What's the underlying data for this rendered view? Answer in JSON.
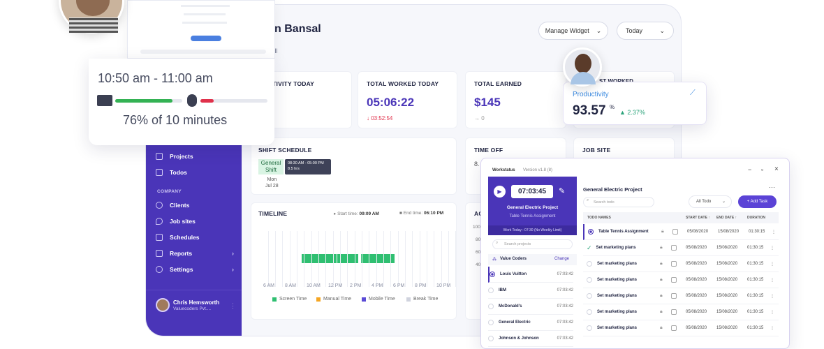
{
  "dashboard": {
    "user_name": "aran Bansal",
    "tab_all": "All",
    "manage_widget": "Manage Widget",
    "period": "Today",
    "cards": {
      "activity": {
        "title": "L ACTIVITY TODAY",
        "value": "%"
      },
      "worked": {
        "title": "TOTAL WORKED TODAY",
        "value": "05:06:22",
        "delta": "↓ 03:52:54"
      },
      "earned": {
        "title": "TOTAL EARNED",
        "value": "$145",
        "delta": "→ 0"
      },
      "shift": {
        "title": "SHIFT SCHEDULE",
        "chip_line1": "General",
        "chip_line2": "Shift",
        "tip_time": "08:30 AM - 05:00 PM",
        "tip_hours": "8.5 hrs",
        "day": "Mon",
        "date": "Jul 28"
      },
      "timeoff": {
        "title": "TIME OFF",
        "value": "8."
      },
      "jobsite": {
        "title": "JOB SITE"
      },
      "timeline": {
        "title": "TIMELINE",
        "start_label": "Start time:",
        "start_value": "09:09 AM",
        "end_label": "End time:",
        "end_value": "06:10 PM",
        "hours": [
          "6 AM",
          "8 AM",
          "10 AM",
          "12 PM",
          "2 PM",
          "4 PM",
          "6 PM",
          "8 PM",
          "10 PM"
        ],
        "legend": [
          "Screen Time",
          "Manual Time",
          "Mobile Time",
          "Break Time"
        ],
        "legend_colors": [
          "#2fbf71",
          "#f5a623",
          "#5b4bd6",
          "#d0d3de"
        ]
      },
      "activity2": {
        "title": "AC",
        "tick1": "100",
        "tick2": "80",
        "tick3": "60",
        "tick4": "40"
      }
    },
    "sidebar": {
      "items_top": [
        {
          "label": "Projects",
          "icon": "projects-icon"
        },
        {
          "label": "Todos",
          "icon": "todos-icon"
        }
      ],
      "section": "COMPANY",
      "items": [
        {
          "label": "Clients",
          "icon": "clients-icon"
        },
        {
          "label": "Job sites",
          "icon": "jobsites-icon"
        },
        {
          "label": "Schedules",
          "icon": "schedules-icon"
        },
        {
          "label": "Reports",
          "icon": "reports-icon",
          "chevron": "›"
        },
        {
          "label": "Settings",
          "icon": "settings-icon",
          "chevron": "›"
        }
      ],
      "profile_name": "Chris Hemsworth",
      "profile_company": "Valuecoders Pvt...."
    }
  },
  "activity_popup": {
    "time_range": "10:50 am - 11:00 am",
    "summary": "76% of 10 minutes",
    "keyboard_level": 0.85,
    "mouse_level": 0.2
  },
  "productivity_popup": {
    "label": "Productivity",
    "value": "93.57",
    "unit": "%",
    "change": "▲ 2.37%",
    "hidden_title": "ST WORKED"
  },
  "workstatus": {
    "app_name": "Workstatus",
    "version": "Version v1.8 (8)",
    "timer": "07:03:45",
    "project": "General Electric Project",
    "task": "Table Tennis Assignment",
    "work_today": "Work Today : 07:30 (No Weekly Limit)",
    "search_projects": "Search projects",
    "org": "Value Coders",
    "change": "Change",
    "projects": [
      {
        "name": "Louis Vuitton",
        "time": "07:03:42"
      },
      {
        "name": "IBM",
        "time": "07:03:42"
      },
      {
        "name": "McDonald's",
        "time": "07:03:42"
      },
      {
        "name": "General Electric",
        "time": "07:03:42"
      },
      {
        "name": "Johnson & Johnson",
        "time": "07:03:42"
      }
    ],
    "right_title": "General Electric Project",
    "search_todo": "Search todo",
    "filter": "All Todo",
    "add_task": "+ Add Task",
    "headers": [
      "TODO NAMES",
      "START DATE ↑",
      "END DATE ↑",
      "DURATION"
    ],
    "todos": [
      {
        "name": "Table Tennis Assignment",
        "start": "05/08/2020",
        "end": "15/08/2020",
        "dur": "01:30:15"
      },
      {
        "name": "Set marketing plans",
        "start": "05/08/2020",
        "end": "15/08/2020",
        "dur": "01:30:15"
      },
      {
        "name": "Set marketing plans",
        "start": "05/08/2020",
        "end": "15/08/2020",
        "dur": "01:30:15"
      },
      {
        "name": "Set marketing plans",
        "start": "05/08/2020",
        "end": "15/08/2020",
        "dur": "01:30:15"
      },
      {
        "name": "Set marketing plans",
        "start": "05/08/2020",
        "end": "15/08/2020",
        "dur": "01:30:15"
      },
      {
        "name": "Set marketing plans",
        "start": "05/08/2020",
        "end": "15/08/2020",
        "dur": "01:30:15"
      },
      {
        "name": "Set marketing plans",
        "start": "05/08/2020",
        "end": "15/08/2020",
        "dur": "01:30:15"
      }
    ],
    "window_controls": [
      "−",
      "▫",
      "×"
    ]
  }
}
